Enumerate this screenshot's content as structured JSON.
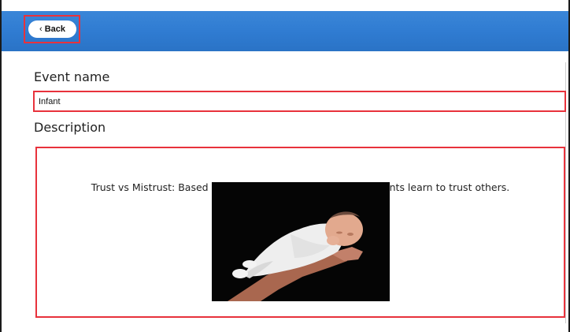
{
  "header": {
    "back_label": "Back"
  },
  "form": {
    "event_name_label": "Event name",
    "event_name_value": "Infant",
    "description_label": "Description",
    "description_text": "Trust vs Mistrust: Based on response of their caregivers, infants learn to trust others."
  },
  "colors": {
    "header_blue": "#2f7bd1",
    "highlight_red": "#e8323c"
  },
  "icons": {
    "back": "chevron-left-icon"
  }
}
